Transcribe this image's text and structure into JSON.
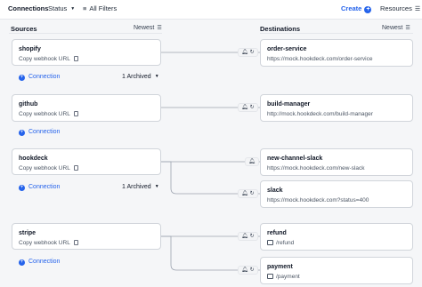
{
  "header": {
    "title": "Connections",
    "status_label": "Status",
    "filters_label": "All Filters",
    "create_label": "Create",
    "resources_label": "Resources"
  },
  "sources_column": {
    "title": "Sources",
    "sort_label": "Newest"
  },
  "destinations_column": {
    "title": "Destinations",
    "sort_label": "Newest"
  },
  "copy_url_label": "Copy webhook URL",
  "connection_label": "Connection",
  "sources": [
    {
      "name": "shopify",
      "archived_label": "1 Archived"
    },
    {
      "name": "github",
      "archived_label": ""
    },
    {
      "name": "hookdeck",
      "archived_label": "1 Archived"
    },
    {
      "name": "stripe",
      "archived_label": ""
    }
  ],
  "destinations": [
    {
      "name": "order-service",
      "url": "https://mock.hookdeck.com/order-service"
    },
    {
      "name": "build-manager",
      "url": "http://mock.hookdeck.com/build-manager"
    },
    {
      "name": "new-channel-slack",
      "url": "https://mock.hookdeck.com/new-slack"
    },
    {
      "name": "slack",
      "url": "https://mock.hookdeck.com?status=400"
    },
    {
      "name": "refund",
      "url": "/refund"
    },
    {
      "name": "payment",
      "url": "/payment"
    }
  ],
  "icons": {
    "status_caret": "chevron-down-icon",
    "filter": "filter-icon",
    "create": "plus-icon",
    "resources": "menu-icon",
    "copy": "copy-icon",
    "pause": "bell-icon",
    "retry": "retry-icon",
    "cli_path": "image-icon"
  },
  "colors": {
    "accent": "#2563eb",
    "card_border": "#d1d5db",
    "line": "#9ca3af"
  }
}
